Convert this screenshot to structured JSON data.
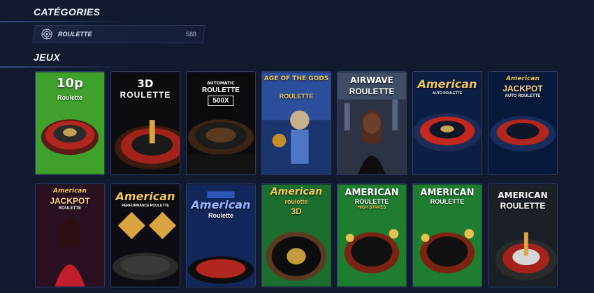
{
  "categories": {
    "title": "CATÉGORIES",
    "items": [
      {
        "label": "ROULETTE",
        "count": "588",
        "icon": "roulette-icon"
      }
    ]
  },
  "games": {
    "title": "JEUX",
    "items": [
      {
        "id": "g1",
        "title": "10p",
        "subtitle": "Roulette",
        "theme": "green"
      },
      {
        "id": "g2",
        "title": "3D",
        "subtitle": "ROULETTE",
        "theme": "dark-gold"
      },
      {
        "id": "g3",
        "title": "AUTOMATIC",
        "subtitle": "ROULETTE",
        "badge": "500X",
        "theme": "black"
      },
      {
        "id": "g4",
        "title": "AGE OF THE GODS",
        "subtitle": "ROULETTE",
        "theme": "blue-gold"
      },
      {
        "id": "g5",
        "title": "AIRWAVE",
        "subtitle": "ROULETTE",
        "theme": "city"
      },
      {
        "id": "g6",
        "title": "American",
        "subtitle": "AUTO ROULETTE",
        "theme": "navy-red"
      },
      {
        "id": "g7",
        "title": "American",
        "subtitle": "JACKPOT",
        "extra": "AUTO ROULETTE",
        "theme": "navy-red2"
      },
      {
        "id": "g8",
        "title": "American",
        "subtitle": "JACKPOT",
        "extra": "ROULETTE",
        "theme": "dealer"
      },
      {
        "id": "g9",
        "title": "American",
        "subtitle": "PERFORMANCE ROULETTE",
        "theme": "gold-black"
      },
      {
        "id": "g10",
        "title": "American",
        "subtitle": "Roulette",
        "theme": "stars"
      },
      {
        "id": "g11",
        "title": "American",
        "subtitle": "roulette",
        "extra": "3D",
        "theme": "green-wheel"
      },
      {
        "id": "g12",
        "title": "AMERICAN",
        "subtitle": "ROULETTE",
        "extra": "HIGH STAKES",
        "theme": "green-coins"
      },
      {
        "id": "g13",
        "title": "AMERICAN",
        "subtitle": "ROULETTE",
        "theme": "green-coins2"
      },
      {
        "id": "g14",
        "title": "AMERICAN",
        "subtitle": "ROULETTE",
        "theme": "gray"
      }
    ]
  }
}
